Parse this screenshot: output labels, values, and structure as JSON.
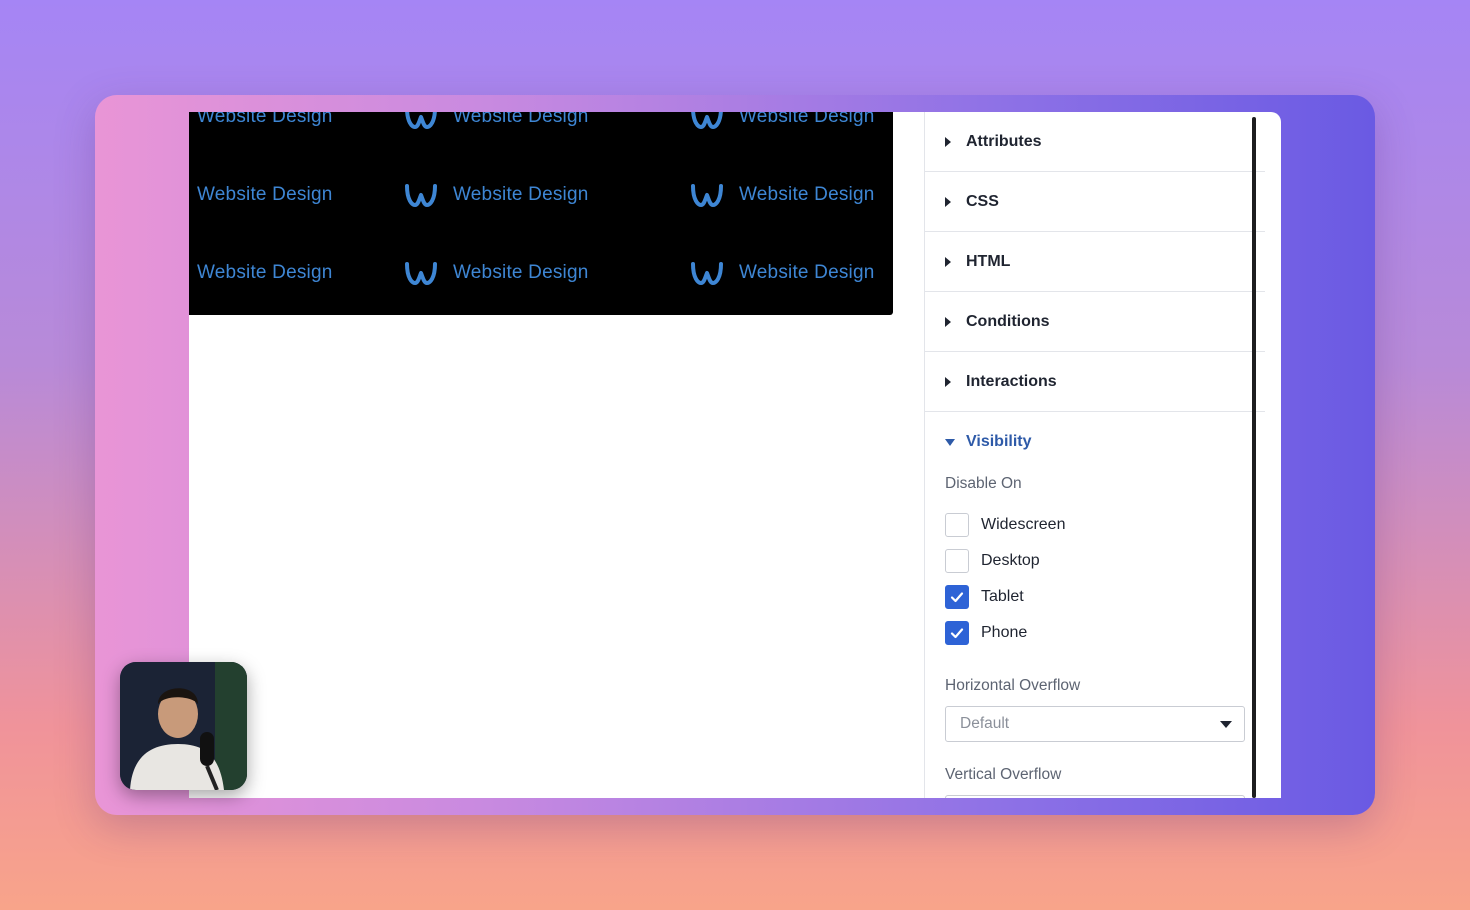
{
  "banner": {
    "tile_text": "Website Design",
    "rows": [
      [
        "Website Design",
        "Website Design",
        "Website Design"
      ],
      [
        "Website Design",
        "Website Design",
        "Website Design"
      ],
      [
        "Website Design",
        "Website Design",
        "Website Design"
      ]
    ],
    "logo_icon": "weebly-w-icon",
    "accent": "#3e86d4"
  },
  "panel": {
    "sections": [
      {
        "label": "Attributes"
      },
      {
        "label": "CSS"
      },
      {
        "label": "HTML"
      },
      {
        "label": "Conditions"
      },
      {
        "label": "Interactions"
      }
    ],
    "visibility": {
      "label": "Visibility",
      "disable_on_label": "Disable On",
      "options": [
        {
          "label": "Widescreen",
          "checked": false
        },
        {
          "label": "Desktop",
          "checked": false
        },
        {
          "label": "Tablet",
          "checked": true
        },
        {
          "label": "Phone",
          "checked": true
        }
      ],
      "horizontal_overflow_label": "Horizontal Overflow",
      "horizontal_overflow_value": "Default",
      "vertical_overflow_label": "Vertical Overflow"
    },
    "accent": "#2e63d6"
  }
}
